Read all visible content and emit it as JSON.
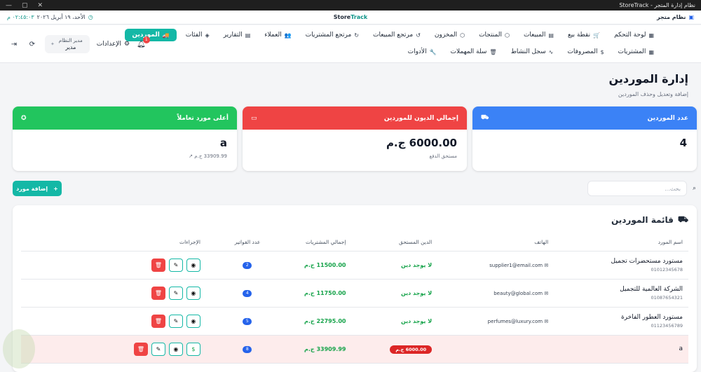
{
  "window": {
    "title": "نظام إدارة المتجر - StoreTrack"
  },
  "topbar": {
    "brand": "نظام متجر",
    "center_prefix": "Store",
    "center_suffix": "Track",
    "date": "الأحد، ١٩ أبريل ٢٠٢٦",
    "time": "٠٢:٤٥:٠٣ م"
  },
  "nav": {
    "row1": [
      {
        "label": "لوحة التحكم",
        "icon": "▦"
      },
      {
        "label": "نقطة بيع",
        "icon": "🛒"
      },
      {
        "label": "المبيعات",
        "icon": "▤"
      },
      {
        "label": "المنتجات",
        "icon": "⬡"
      },
      {
        "label": "المخزون",
        "icon": "⬡"
      },
      {
        "label": "مرتجع المبيعات",
        "icon": "↺"
      },
      {
        "label": "مرتجع المشتريات",
        "icon": "↻"
      },
      {
        "label": "العملاء",
        "icon": "👥"
      },
      {
        "label": "التقارير",
        "icon": "▤"
      },
      {
        "label": "الفئات",
        "icon": "◈"
      },
      {
        "label": "الموردين",
        "icon": "🚚"
      }
    ],
    "row2": [
      {
        "label": "المشتريات",
        "icon": "▦"
      },
      {
        "label": "المصروفات",
        "icon": "$"
      },
      {
        "label": "سجل النشاط",
        "icon": "∿"
      },
      {
        "label": "سلة المهملات",
        "icon": "🗑"
      },
      {
        "label": "الأدوات",
        "icon": "🔧"
      }
    ],
    "settings": "الإعدادات",
    "user_role": "مدير النظام",
    "user_name": "مدير",
    "notif_count": "1"
  },
  "page": {
    "title": "إدارة الموردين",
    "subtitle": "إضافة وتعديل وحذف الموردين"
  },
  "cards": {
    "count": {
      "title": "عدد الموردين",
      "value": "4"
    },
    "debt": {
      "title": "إجمالي الديون للموردين",
      "value": "6000.00 ج.م",
      "sub": "مستحق الدفع"
    },
    "top": {
      "title": "أعلى مورد تعاملاً",
      "value": "a",
      "sub": "33909.99 ج.م"
    }
  },
  "toolbar": {
    "search_placeholder": "بحث...",
    "add_label": "إضافة مورد"
  },
  "table": {
    "title": "قائمة الموردين",
    "headers": [
      "اسم المورد",
      "الهاتف",
      "الدين المستحق",
      "إجمالي المشتريات",
      "عدد الفواتير",
      "الإجراءات"
    ],
    "rows": [
      {
        "name": "مستورد مستحضرات تجميل",
        "phone": "01012345678",
        "email": "supplier1@email.com",
        "debt": "لا يوجد دين",
        "total": "11500.00 ج.م",
        "count": "2"
      },
      {
        "name": "الشركة العالمية للتجميل",
        "phone": "01087654321",
        "email": "beauty@global.com",
        "debt": "لا يوجد دين",
        "total": "11750.00 ج.م",
        "count": "4"
      },
      {
        "name": "مستورد العطور الفاخرة",
        "phone": "01123456789",
        "email": "perfumes@luxury.com",
        "debt": "لا يوجد دين",
        "total": "22795.00 ج.م",
        "count": "5"
      },
      {
        "name": "a",
        "phone": "",
        "email": "",
        "debt": "6000.00 ج.م",
        "total": "33909.99 ج.م",
        "count": "8"
      }
    ]
  },
  "colors": {
    "accent": "#14b8a6",
    "blue": "#3b82f6",
    "red": "#ef4444",
    "green": "#22c55e"
  }
}
